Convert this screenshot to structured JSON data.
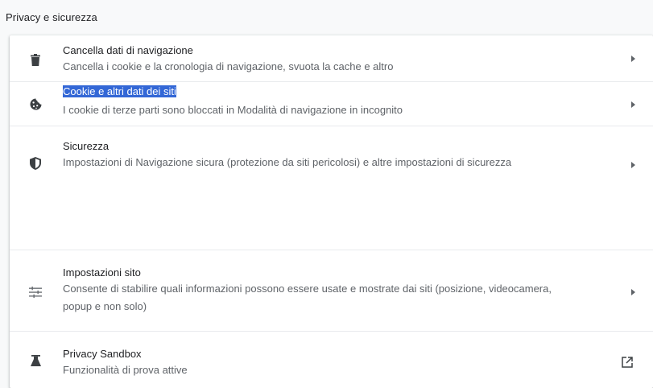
{
  "section": {
    "title": "Privacy e sicurezza"
  },
  "rows": [
    {
      "icon": "trash-icon",
      "title": "Cancella dati di navigazione",
      "subtitle": "Cancella i cookie e la cronologia di navigazione, svuota la cache e altro",
      "action_icon": "chevron-right-icon"
    },
    {
      "icon": "cookie-icon",
      "title": "Cookie e altri dati dei siti",
      "subtitle": "I cookie di terze parti sono bloccati in Modalità di navigazione in incognito",
      "action_icon": "chevron-right-icon",
      "title_selected": true
    },
    {
      "icon": "shield-icon",
      "title": "Sicurezza",
      "subtitle": "Impostazioni di Navigazione sicura (protezione da siti pericolosi) e altre impostazioni di sicurezza",
      "action_icon": "chevron-right-icon"
    },
    {
      "icon": "tune-icon",
      "title": "Impostazioni sito",
      "subtitle": "Consente di stabilire quali informazioni possono essere usate e mostrate dai siti (posizione, videocamera, popup e non solo)",
      "action_icon": "chevron-right-icon"
    },
    {
      "icon": "flask-icon",
      "title": "Privacy Sandbox",
      "subtitle": "Funzionalità di prova attive",
      "action_icon": "open-in-new-icon"
    }
  ],
  "colors": {
    "background": "#f8f9fa",
    "card": "#ffffff",
    "primary_text": "#202124",
    "secondary_text": "#5f6368",
    "icon": "#5f6368",
    "selection": "#3367d6"
  }
}
